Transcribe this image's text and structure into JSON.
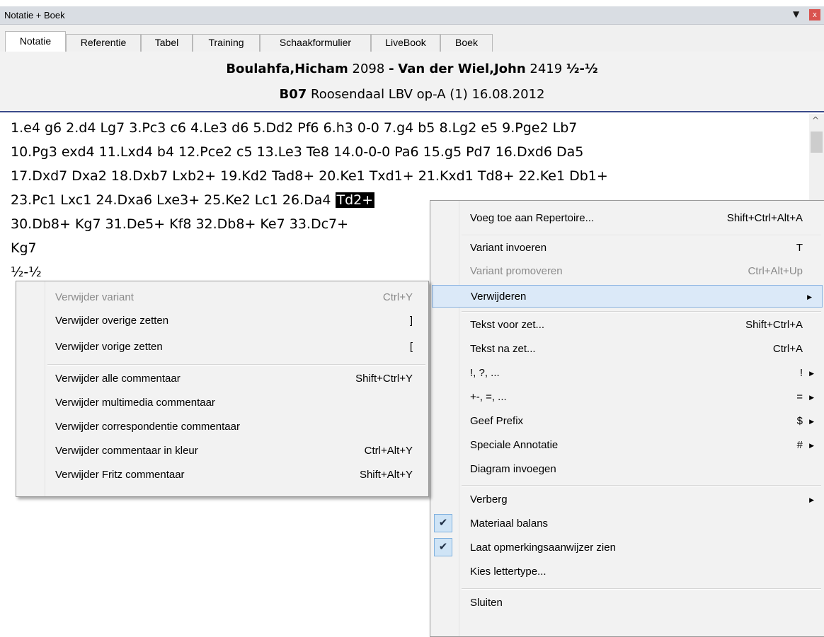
{
  "window": {
    "title": "Notatie + Boek"
  },
  "tabs": [
    "Notatie",
    "Referentie",
    "Tabel",
    "Training",
    "Schaakformulier",
    "LiveBook",
    "Boek"
  ],
  "game": {
    "white": "Boulahfa,Hicham",
    "white_elo": "2098",
    "black": "Van der Wiel,John",
    "black_elo": "2419",
    "result": "½-½",
    "eco": "B07",
    "event": "Roosendaal LBV op-A (1) 16.08.2012"
  },
  "notation": {
    "line1": "1.e4  g6  2.d4  Lg7  3.Pc3  c6  4.Le3  d6  5.Dd2  Pf6  6.h3  0-0  7.g4  b5  8.Lg2  e5  9.Pge2  Lb7",
    "line2": "10.Pg3  exd4  11.Lxd4  b4  12.Pce2  c5  13.Le3  Te8  14.0-0-0  Pa6  15.g5  Pd7  16.Dxd6  Da5",
    "line3": "17.Dxd7  Dxa2  18.Dxb7  Lxb2+  19.Kd2  Tad8+  20.Ke1  Txd1+  21.Kxd1  Td8+  22.Ke1  Db1+",
    "line4_pre": "23.Pc1  Lxc1  24.Dxa6  Lxe3+  25.Ke2  Lc1  26.Da4 ",
    "line4_sel": "Td2+",
    "line5": "30.Db8+  Kg7  31.De5+  Kf8  32.Db8+  Ke7  33.Dc7+",
    "line6": "Kg7",
    "line7": "½-½"
  },
  "context_menu": {
    "items": [
      {
        "label": "Voeg toe aan Repertoire...",
        "shortcut": "Shift+Ctrl+Alt+A"
      },
      {
        "label": "Variant invoeren",
        "shortcut": "T"
      },
      {
        "label": "Variant promoveren",
        "shortcut": "Ctrl+Alt+Up"
      },
      {
        "label": "Verwijderen",
        "shortcut": ""
      },
      {
        "label": "Tekst voor zet...",
        "shortcut": "Shift+Ctrl+A"
      },
      {
        "label": "Tekst na zet...",
        "shortcut": "Ctrl+A"
      },
      {
        "label": "!, ?, ...",
        "shortcut": "!"
      },
      {
        "label": "+-, =, ...",
        "shortcut": "="
      },
      {
        "label": "Geef Prefix",
        "shortcut": "$"
      },
      {
        "label": "Speciale Annotatie",
        "shortcut": "#"
      },
      {
        "label": "Diagram invoegen",
        "shortcut": ""
      },
      {
        "label": "Verberg",
        "shortcut": ""
      },
      {
        "label": "Materiaal balans",
        "shortcut": ""
      },
      {
        "label": "Laat opmerkingsaanwijzer zien",
        "shortcut": ""
      },
      {
        "label": "Kies lettertype...",
        "shortcut": ""
      },
      {
        "label": "Sluiten",
        "shortcut": ""
      }
    ]
  },
  "submenu": {
    "items": [
      {
        "label": "Verwijder variant",
        "shortcut": "Ctrl+Y"
      },
      {
        "label": "Verwijder overige zetten",
        "shortcut": "]"
      },
      {
        "label": "Verwijder vorige zetten",
        "shortcut": "["
      },
      {
        "label": "Verwijder alle commentaar",
        "shortcut": "Shift+Ctrl+Y"
      },
      {
        "label": "Verwijder multimedia commentaar",
        "shortcut": ""
      },
      {
        "label": "Verwijder correspondentie commentaar",
        "shortcut": ""
      },
      {
        "label": "Verwijder commentaar in kleur",
        "shortcut": "Ctrl+Alt+Y"
      },
      {
        "label": "Verwijder Fritz commentaar",
        "shortcut": "Shift+Alt+Y"
      }
    ]
  }
}
